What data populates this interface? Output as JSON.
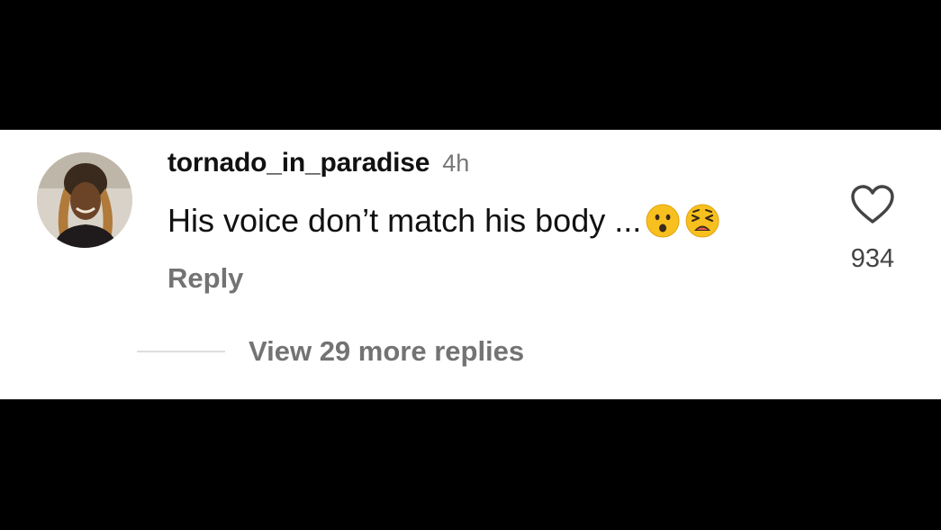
{
  "comment": {
    "username": "tornado_in_paradise",
    "timestamp": "4h",
    "text": "His voice don’t match his body ...",
    "emojis": [
      "frowning-face-with-open-mouth-emoji",
      "weary-face-emoji"
    ],
    "reply_label": "Reply",
    "like_icon": "heart-outline-icon",
    "like_count": "934"
  },
  "replies": {
    "view_more_label": "View 29 more replies"
  },
  "colors": {
    "background_bars": "#000000",
    "card": "#ffffff",
    "primary_text": "#111111",
    "secondary_text": "#737373",
    "emoji_yellow": "#f7c01e"
  }
}
